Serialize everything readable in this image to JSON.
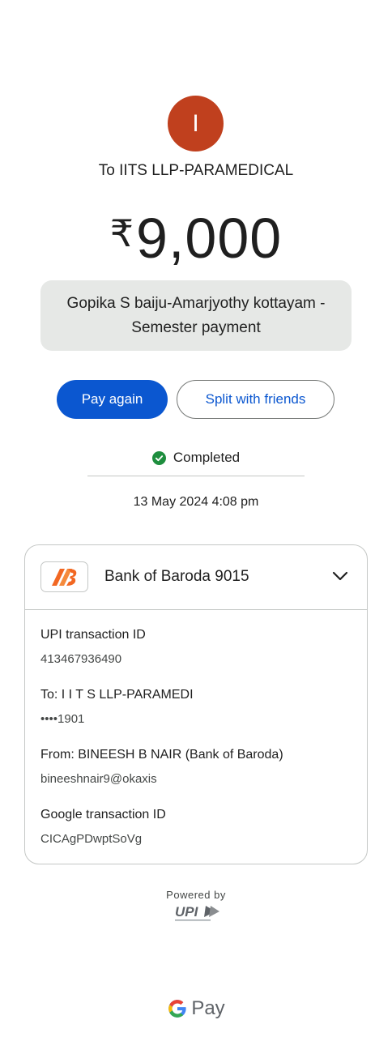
{
  "header": {
    "avatar_initial": "I",
    "payee": "To IITS LLP-PARAMEDICAL"
  },
  "amount": {
    "currency": "₹",
    "value": "9,000"
  },
  "note": "Gopika S baiju-Amarjyothy kottayam - Semester payment",
  "actions": {
    "pay_again": "Pay again",
    "split": "Split with friends"
  },
  "status": {
    "text": "Completed",
    "datetime": "13 May 2024 4:08 pm"
  },
  "bank_card": {
    "bank_name": "Bank of Baroda 9015",
    "fields": [
      {
        "label": "UPI transaction ID",
        "value": "413467936490"
      },
      {
        "label": "To: I I T S LLP-PARAMEDI",
        "value": "••••1901"
      },
      {
        "label": "From: BINEESH B NAIR (Bank of Baroda)",
        "value": "bineeshnair9@okaxis"
      },
      {
        "label": "Google transaction ID",
        "value": "CICAgPDwptSoVg"
      }
    ]
  },
  "footer": {
    "powered_by": "Powered by",
    "upi": "UPI",
    "gpay": "Pay"
  },
  "colors": {
    "avatar": "#c0401e",
    "primary": "#0b57d0",
    "success": "#1e8e3e"
  }
}
